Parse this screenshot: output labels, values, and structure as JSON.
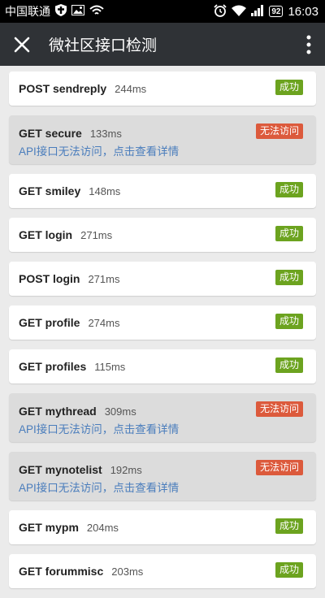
{
  "status_bar": {
    "carrier": "中国联通",
    "battery": "92",
    "time": "16:03"
  },
  "toolbar": {
    "title": "微社区接口检测"
  },
  "colors": {
    "toolbar_bg": "#2f3236",
    "success_badge": "#6ca31f",
    "fail_badge": "#dc5a3c",
    "link": "#4a7dbc"
  },
  "requests": [
    {
      "method_path": "POST sendreply",
      "time": "244ms",
      "status": "成功",
      "ok": true
    },
    {
      "method_path": "GET secure",
      "time": "133ms",
      "status": "无法访问",
      "ok": false,
      "error": "API接口无法访问，点击查看详情"
    },
    {
      "method_path": "GET smiley",
      "time": "148ms",
      "status": "成功",
      "ok": true
    },
    {
      "method_path": "GET login",
      "time": "271ms",
      "status": "成功",
      "ok": true
    },
    {
      "method_path": "POST login",
      "time": "271ms",
      "status": "成功",
      "ok": true
    },
    {
      "method_path": "GET profile",
      "time": "274ms",
      "status": "成功",
      "ok": true
    },
    {
      "method_path": "GET profiles",
      "time": "115ms",
      "status": "成功",
      "ok": true
    },
    {
      "method_path": "GET mythread",
      "time": "309ms",
      "status": "无法访问",
      "ok": false,
      "error": "API接口无法访问，点击查看详情"
    },
    {
      "method_path": "GET mynotelist",
      "time": "192ms",
      "status": "无法访问",
      "ok": false,
      "error": "API接口无法访问，点击查看详情"
    },
    {
      "method_path": "GET mypm",
      "time": "204ms",
      "status": "成功",
      "ok": true
    },
    {
      "method_path": "GET forummisc",
      "time": "203ms",
      "status": "成功",
      "ok": true
    }
  ]
}
